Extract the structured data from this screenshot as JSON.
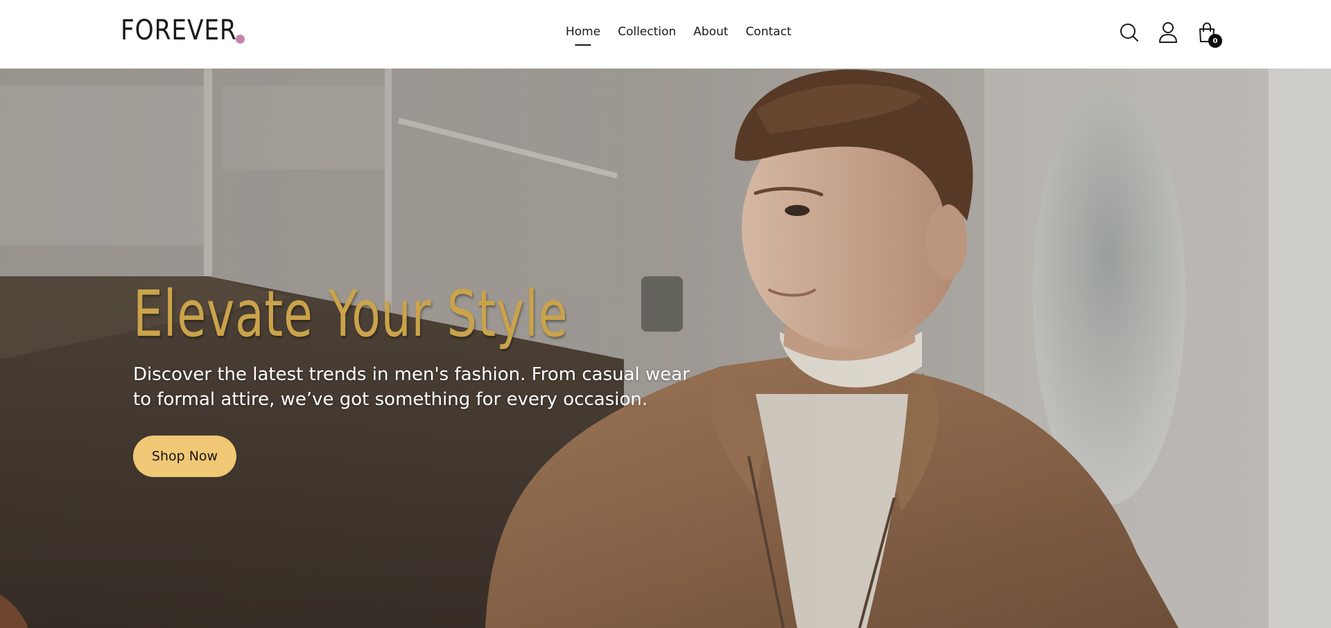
{
  "brand": {
    "logo_text": "FOREVER",
    "accent_dot_color": "#c586a5"
  },
  "nav": {
    "items": [
      {
        "label": "Home",
        "active": true
      },
      {
        "label": "Collection",
        "active": false
      },
      {
        "label": "About",
        "active": false
      },
      {
        "label": "Contact",
        "active": false
      }
    ]
  },
  "header_icons": {
    "search": "search-icon",
    "account": "user-icon",
    "cart": "shopping-bag-icon",
    "cart_count": "0"
  },
  "hero": {
    "title": "Elevate Your Style",
    "description": "Discover the latest trends in men's fashion. From casual wear to formal attire, we’ve got something for every occasion.",
    "cta_label": "Shop Now",
    "title_color": "#caa34a",
    "cta_color": "#f0c876",
    "image_subject": "man-in-suede-jacket-photo"
  }
}
